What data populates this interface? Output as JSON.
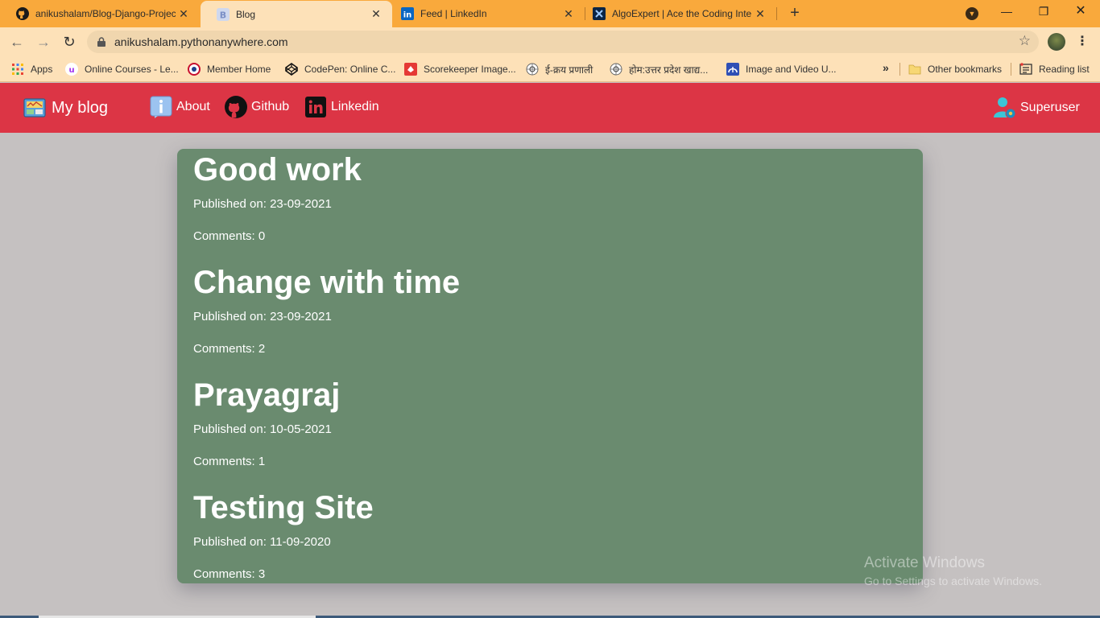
{
  "browser": {
    "tabs": [
      {
        "title": "anikushalam/Blog-Django-Projec",
        "icon": "github-icon",
        "active": false
      },
      {
        "title": "Blog",
        "icon": "bootstrap-icon",
        "active": true
      },
      {
        "title": "Feed | LinkedIn",
        "icon": "linkedin-icon",
        "active": false
      },
      {
        "title": "AlgoExpert | Ace the Coding Inte",
        "icon": "algoexpert-icon",
        "active": false
      }
    ],
    "new_tab_label": "+",
    "url": "anikushalam.pythonanywhere.com",
    "bookmarks": [
      {
        "label": "Apps",
        "icon": "apps-grid-icon"
      },
      {
        "label": "Online Courses - Le...",
        "icon": "udemy-icon"
      },
      {
        "label": "Member Home",
        "icon": "member-home-icon"
      },
      {
        "label": "CodePen: Online C...",
        "icon": "codepen-icon"
      },
      {
        "label": "Scorekeeper Image...",
        "icon": "scorekeeper-icon"
      },
      {
        "label": "ई-क्रय प्रणाली",
        "icon": "emblem-icon"
      },
      {
        "label": "होम:उत्तर प्रदेश खाद्य...",
        "icon": "emblem-icon"
      },
      {
        "label": "Image and Video U...",
        "icon": "image-upload-icon"
      }
    ],
    "bookmarks_overflow": "»",
    "other_bookmarks": "Other bookmarks",
    "reading_list": "Reading list",
    "colors": {
      "tabstrip": "#f9a93c",
      "toolbar": "#fde1b8"
    }
  },
  "navbar": {
    "brand": "My blog",
    "links": [
      {
        "label": "About",
        "icon": "info-icon"
      },
      {
        "label": "Github",
        "icon": "github-icon"
      },
      {
        "label": "Linkedin",
        "icon": "linkedin-icon"
      }
    ],
    "user": "Superuser",
    "color": "#dc3545"
  },
  "posts": [
    {
      "title": "Good work",
      "published": "Published on: 23-09-2021",
      "comments": "Comments: 0"
    },
    {
      "title": "Change with time",
      "published": "Published on: 23-09-2021",
      "comments": "Comments: 2"
    },
    {
      "title": "Prayagraj",
      "published": "Published on: 10-05-2021",
      "comments": "Comments: 1"
    },
    {
      "title": "Testing Site",
      "published": "Published on: 11-09-2020",
      "comments": "Comments: 3"
    }
  ],
  "panel_color": "#6a8b6f",
  "watermark": {
    "line1": "Activate Windows",
    "line2": "Go to Settings to activate Windows."
  }
}
